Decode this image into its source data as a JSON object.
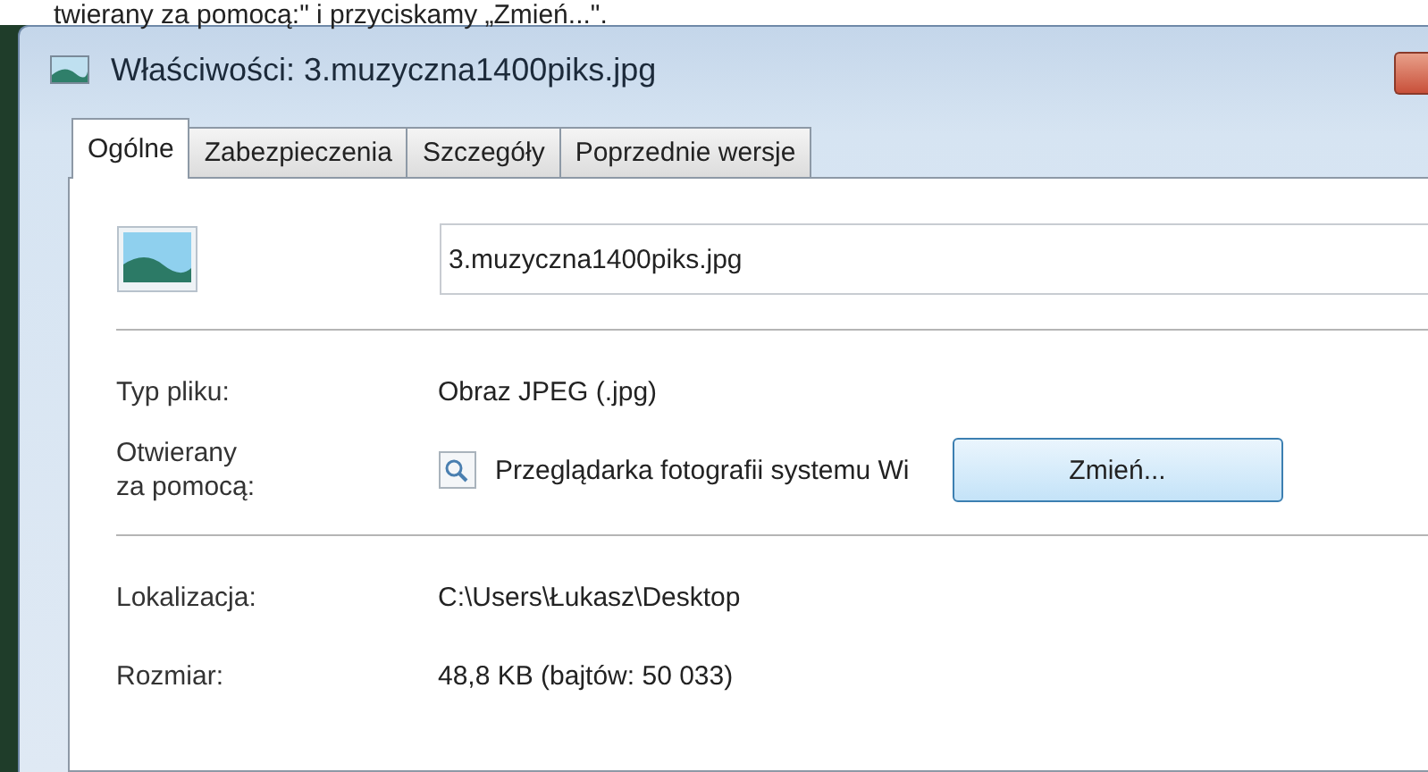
{
  "caption": "twierany za pomocą:\" i przyciskamy „Zmień...\".",
  "window": {
    "title": "Właściwości: 3.muzyczna1400piks.jpg"
  },
  "tabs": [
    {
      "label": "Ogólne",
      "selected": true
    },
    {
      "label": "Zabezpieczenia",
      "selected": false
    },
    {
      "label": "Szczegóły",
      "selected": false
    },
    {
      "label": "Poprzednie wersje",
      "selected": false
    }
  ],
  "file_name": {
    "value": "3.muzyczna1400piks.jpg"
  },
  "properties": [
    {
      "label": "Typ pliku:",
      "value": "Obraz JPEG (.jpg)",
      "kind": "text"
    },
    {
      "label": "Otwierany\nza pomocą:",
      "value": "Przeglądarka fotografii systemu Wi",
      "kind": "app",
      "button": "Zmień..."
    },
    {
      "label": "Lokalizacja:",
      "value": "C:\\Users\\Łukasz\\Desktop",
      "kind": "text",
      "divider_before": true
    },
    {
      "label": "Rozmiar:",
      "value": "48,8 KB (bajtów: 50 033)",
      "kind": "text"
    }
  ]
}
